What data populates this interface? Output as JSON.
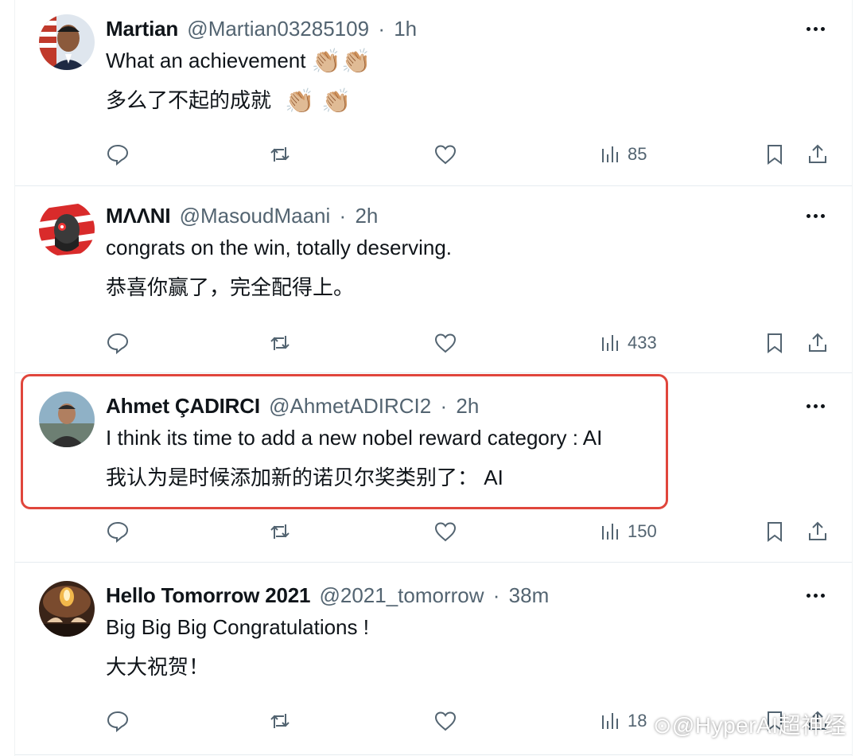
{
  "tweets": [
    {
      "name": "Martian",
      "handle": "@Martian03285109",
      "time": "1h",
      "text_en": "What an achievement",
      "text_en_emoji": "👏🏼👏🏼",
      "text_zh": "多么了不起的成就",
      "text_zh_emoji": "👏🏼 👏🏼",
      "views": "85",
      "avatar_colors": [
        "#2b3a55",
        "#c7a07a"
      ]
    },
    {
      "name": "MΛΛNI",
      "handle": "@MasoudMaani",
      "time": "2h",
      "text_en": "congrats on the win, totally deserving.",
      "text_zh": "恭喜你赢了，完全配得上。",
      "views": "433",
      "avatar_colors": [
        "#d92b2b",
        "#2a2a2a"
      ]
    },
    {
      "name": "Ahmet ÇADIRCI",
      "handle": "@AhmetADIRCI2",
      "time": "2h",
      "text_en": "I think its time to add a new nobel reward category : AI",
      "text_zh": "我认为是时候添加新的诺贝尔奖类别了： AI",
      "views": "150",
      "avatar_colors": [
        "#7fa2b8",
        "#3d3d3d"
      ]
    },
    {
      "name": "Hello Tomorrow 2021",
      "handle": "@2021_tomorrow",
      "time": "38m",
      "text_en": "Big Big Big Congratulations !",
      "text_zh": "大大祝贺！",
      "views": "18",
      "avatar_colors": [
        "#5a3b2a",
        "#e0a64a"
      ]
    }
  ],
  "separator": "·",
  "watermark": "⊙@HyperAI超神经",
  "colors": {
    "highlight": "#e0463c",
    "muted": "#536471",
    "text": "#0f1419"
  },
  "icons": [
    "reply-icon",
    "retweet-icon",
    "like-icon",
    "views-icon",
    "bookmark-icon",
    "share-icon",
    "more-icon"
  ]
}
